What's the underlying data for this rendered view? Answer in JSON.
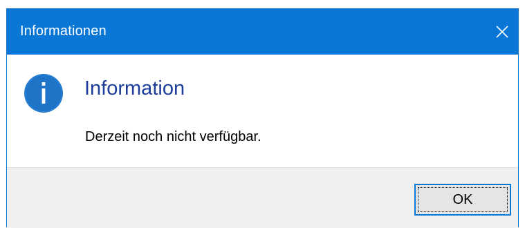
{
  "window": {
    "title": "Informationen",
    "close_icon": "close-icon",
    "titlebar_color": "#0a77d6"
  },
  "content": {
    "icon": "info-icon",
    "icon_color": "#1f74c8",
    "heading": "Information",
    "heading_color": "#1c3d9c",
    "message": "Derzeit noch nicht verfügbar."
  },
  "footer": {
    "ok_label": "OK"
  }
}
